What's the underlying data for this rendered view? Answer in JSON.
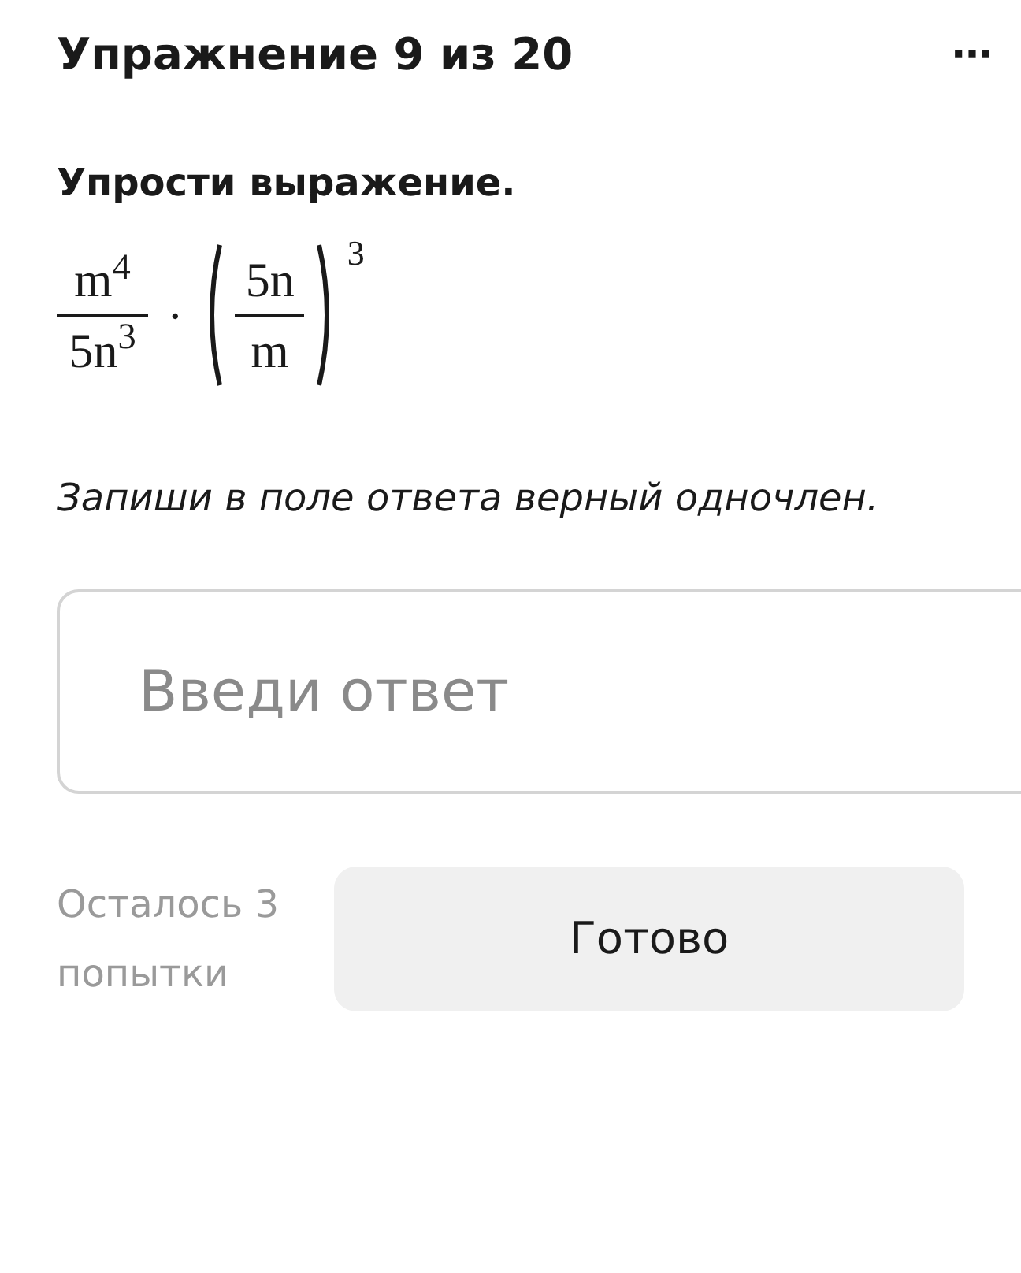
{
  "header": {
    "title": "Упражнение 9 из 20",
    "menu": "⋯"
  },
  "task": {
    "instruction": "Упрости выражение.",
    "expression": {
      "fraction_1": {
        "numerator": "m$^{4}$",
        "denominator": "5n$^{3}$"
      },
      "operator": "·",
      "fraction_2": {
        "numerator": "5n",
        "denominator": "m"
      },
      "exponent": "3"
    },
    "hint": "Запиши в поле ответа верный одночлен."
  },
  "answer": {
    "placeholder": "Введи ответ"
  },
  "footer": {
    "attempts": "Осталось 3 попытки",
    "button": "Готово"
  }
}
